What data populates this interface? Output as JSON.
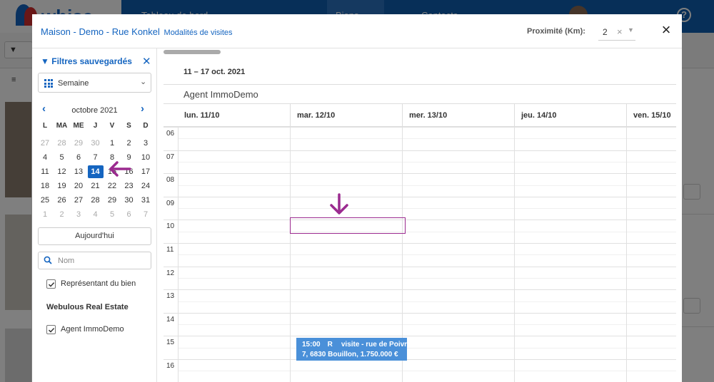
{
  "app": {
    "brand": "whise",
    "tabs": [
      "Tableau de bord",
      "Biens",
      "Contacts"
    ]
  },
  "modal": {
    "title": "Maison - Demo - Rue Konkel",
    "subtitle": "Modalités de visites",
    "proximity": {
      "label": "Proximité (Km):",
      "value": "2"
    }
  },
  "sidebar": {
    "saved_filters": "Filtres sauvegardés",
    "view": "Semaine",
    "month_label": "octobre 2021",
    "weekdays": [
      "L",
      "MA",
      "ME",
      "J",
      "V",
      "S",
      "D"
    ],
    "days": [
      [
        "27",
        "28",
        "29",
        "30",
        "1",
        "2",
        "3"
      ],
      [
        "4",
        "5",
        "6",
        "7",
        "8",
        "9",
        "10"
      ],
      [
        "11",
        "12",
        "13",
        "14",
        "15",
        "16",
        "17"
      ],
      [
        "18",
        "19",
        "20",
        "21",
        "22",
        "23",
        "24"
      ],
      [
        "25",
        "26",
        "27",
        "28",
        "29",
        "30",
        "31"
      ],
      [
        "1",
        "2",
        "3",
        "4",
        "5",
        "6",
        "7"
      ]
    ],
    "today": "14",
    "today_button": "Aujourd'hui",
    "search_placeholder": "Nom",
    "checkbox_representant": "Représentant du bien",
    "agency": "Webulous Real Estate",
    "checkbox_agent": "Agent ImmoDemo"
  },
  "calendar": {
    "range": "11 – 17 oct. 2021",
    "agent": "Agent ImmoDemo",
    "days": [
      "lun. 11/10",
      "mar. 12/10",
      "mer. 13/10",
      "jeu. 14/10",
      "ven. 15/10"
    ],
    "hours": [
      "06",
      "07",
      "08",
      "09",
      "10",
      "11",
      "12",
      "13",
      "14",
      "15",
      "16"
    ],
    "event": {
      "time": "15:00",
      "tag": "R",
      "line1": "visite - rue de Poivre",
      "line2": "7, 6830 Bouillon, 1.750.000 €"
    }
  },
  "colors": {
    "accent": "#1565c0",
    "event": "#4a90d9",
    "annotation": "#9b2a8f"
  }
}
